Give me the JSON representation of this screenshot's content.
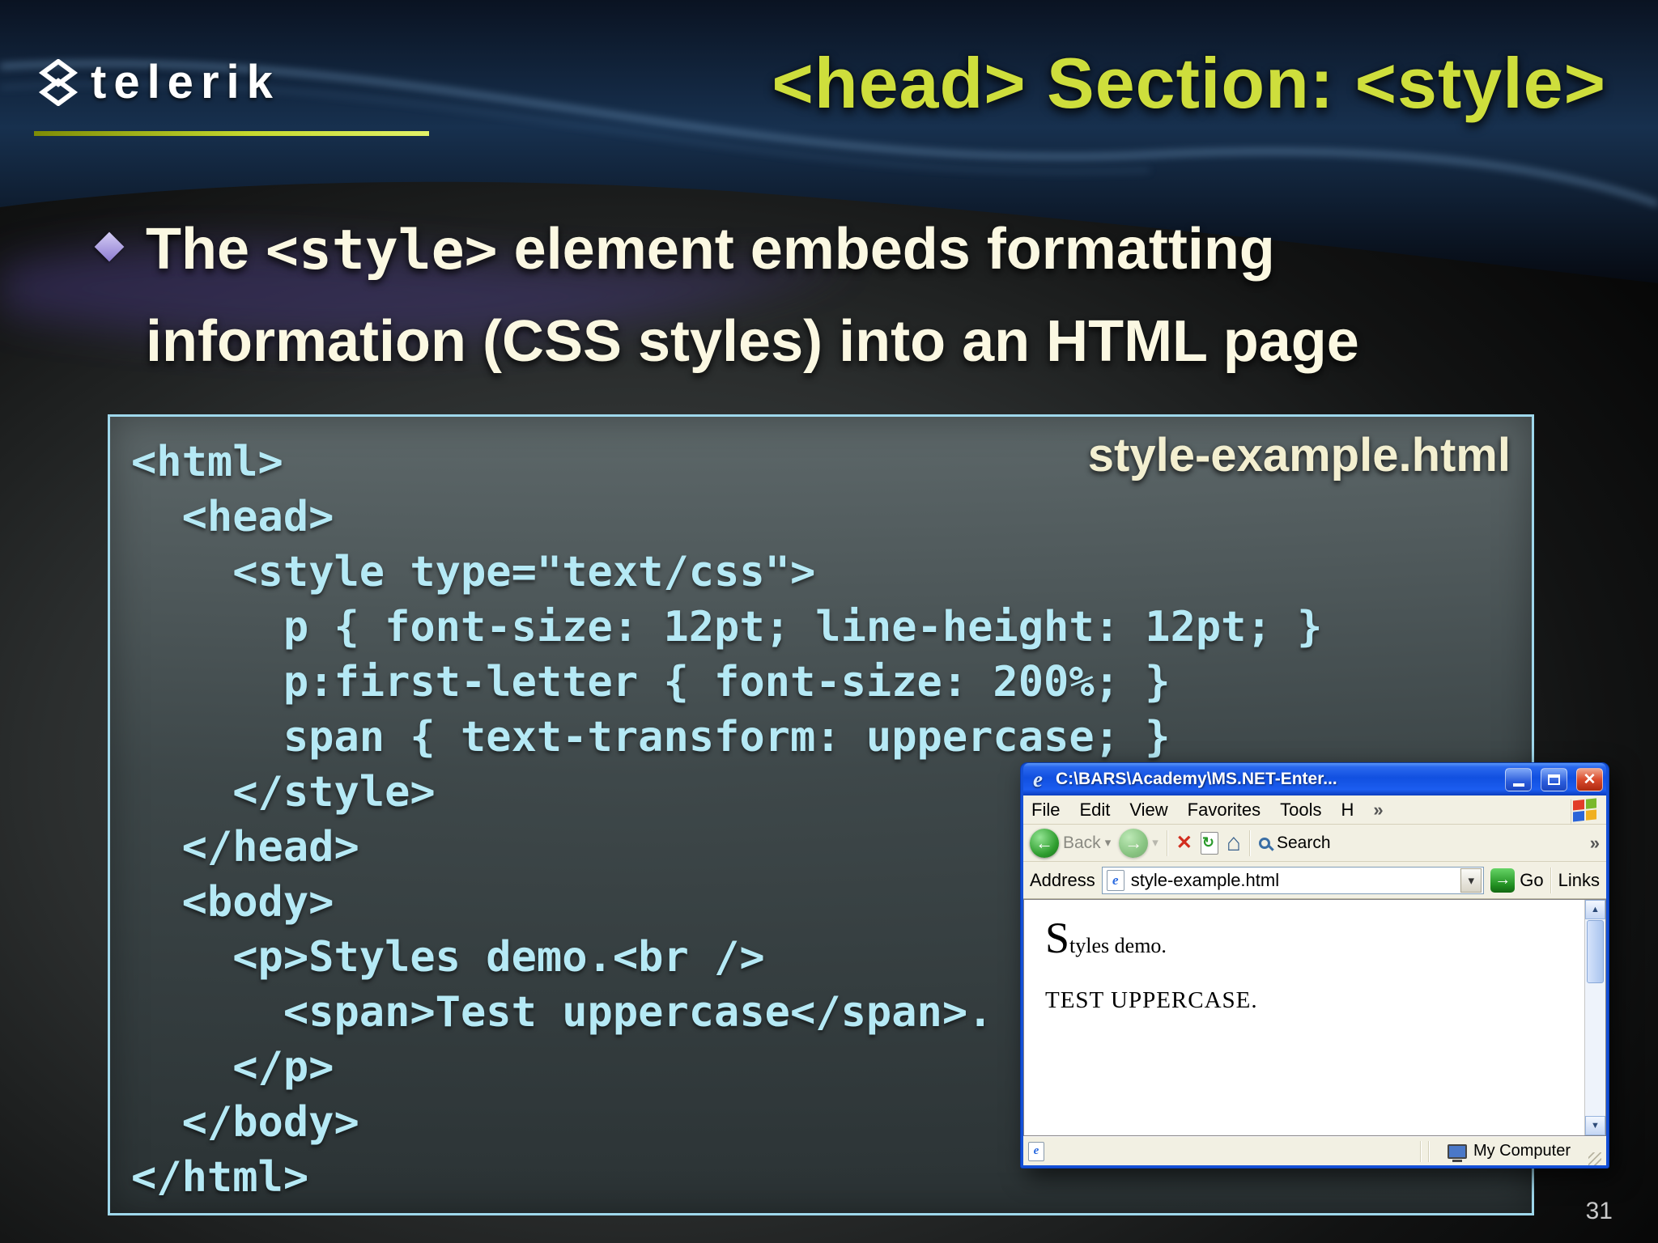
{
  "slide": {
    "logo": "telerik",
    "title": "<head> Section: <style>",
    "page_number": "31",
    "bullet": {
      "pre": "The ",
      "code": "<style>",
      "post": " element embeds formatting information (CSS styles) into an HTML page"
    }
  },
  "code_box": {
    "filename": "style-example.html",
    "lines": [
      "<html>",
      "  <head>",
      "    <style type=\"text/css\">",
      "      p { font-size: 12pt; line-height: 12pt; }",
      "      p:first-letter { font-size: 200%; }",
      "      span { text-transform: uppercase; }",
      "    </style>",
      "  </head>",
      "  <body>",
      "    <p>Styles demo.<br />",
      "      <span>Test uppercase</span>.",
      "    </p>",
      "  </body>",
      "</html>"
    ]
  },
  "browser": {
    "title": "C:\\BARS\\Academy\\MS.NET-Enter...",
    "menu": [
      "File",
      "Edit",
      "View",
      "Favorites",
      "Tools",
      "H"
    ],
    "chevron": "»",
    "toolbar": {
      "back": "Back",
      "search": "Search"
    },
    "address": {
      "label": "Address",
      "value": "style-example.html",
      "go": "Go",
      "links": "Links"
    },
    "content": {
      "dropcap": "S",
      "line1": "tyles demo.",
      "line2": "TEST UPPERCASE."
    },
    "status": {
      "right": "My Computer"
    }
  },
  "colors": {
    "title_green": "#cede3c",
    "bullet_text": "#fbf8e2",
    "code_cyan": "#b5e9f5",
    "box_border": "#9fd8ec",
    "xp_titlebar_blue": "#1553e8",
    "close_red": "#d0432a",
    "go_green": "#2f9e2f"
  }
}
